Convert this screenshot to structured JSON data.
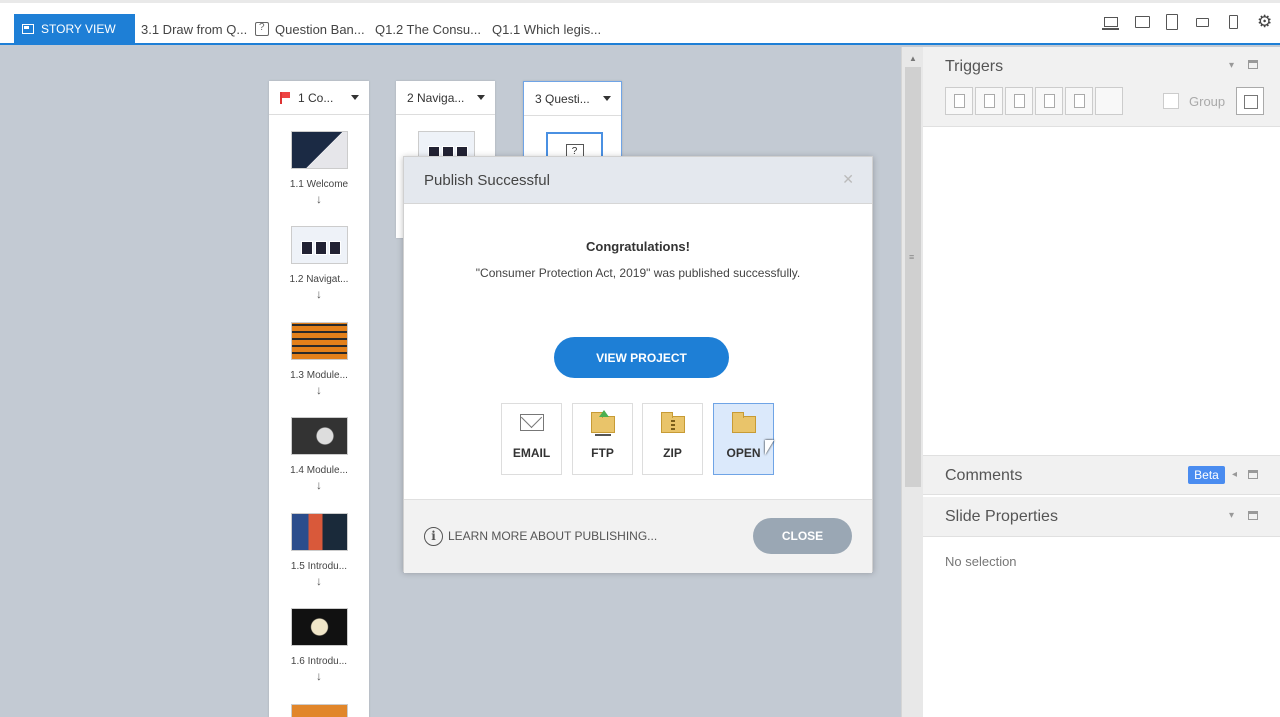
{
  "topbar": {
    "story_view_label": "STORY VIEW",
    "tabs": [
      {
        "label": "3.1 Draw from Q..."
      },
      {
        "label": "Question Ban..."
      },
      {
        "label": "Q1.2 The Consu..."
      },
      {
        "label": "Q1.1 Which legis..."
      }
    ],
    "view_icons": [
      "desktop-icon",
      "tablet-landscape-icon",
      "tablet-portrait-icon",
      "phone-landscape-icon",
      "phone-portrait-icon",
      "gear-icon"
    ]
  },
  "scenes": [
    {
      "label": "1 Co...",
      "slides": [
        {
          "label": "1.1 Welcome"
        },
        {
          "label": "1.2 Navigat..."
        },
        {
          "label": "1.3 Module..."
        },
        {
          "label": "1.4 Module..."
        },
        {
          "label": "1.5 Introdu..."
        },
        {
          "label": "1.6 Introdu..."
        }
      ]
    },
    {
      "label": "2 Naviga..."
    },
    {
      "label": "3 Questi..."
    }
  ],
  "modal": {
    "title": "Publish Successful",
    "heading": "Congratulations!",
    "message": "\"Consumer Protection Act, 2019\" was published successfully.",
    "view_project_label": "VIEW PROJECT",
    "options": [
      {
        "label": "EMAIL",
        "icon": "envelope-icon"
      },
      {
        "label": "FTP",
        "icon": "ftp-folder-icon"
      },
      {
        "label": "ZIP",
        "icon": "zip-folder-icon"
      },
      {
        "label": "OPEN",
        "icon": "open-folder-icon",
        "selected": true
      }
    ],
    "learn_more_label": "LEARN MORE ABOUT PUBLISHING...",
    "close_label": "CLOSE"
  },
  "right_panel": {
    "triggers_title": "Triggers",
    "group_label": "Group",
    "comments_title": "Comments",
    "beta_label": "Beta",
    "slide_properties_title": "Slide Properties",
    "no_selection_label": "No selection"
  },
  "colors": {
    "accent": "#1e7fd6",
    "canvas": "#c3cad3",
    "close_button": "#9aa7b4",
    "selected_option": "#dbe9fb",
    "beta_badge": "#4a8cf0"
  }
}
